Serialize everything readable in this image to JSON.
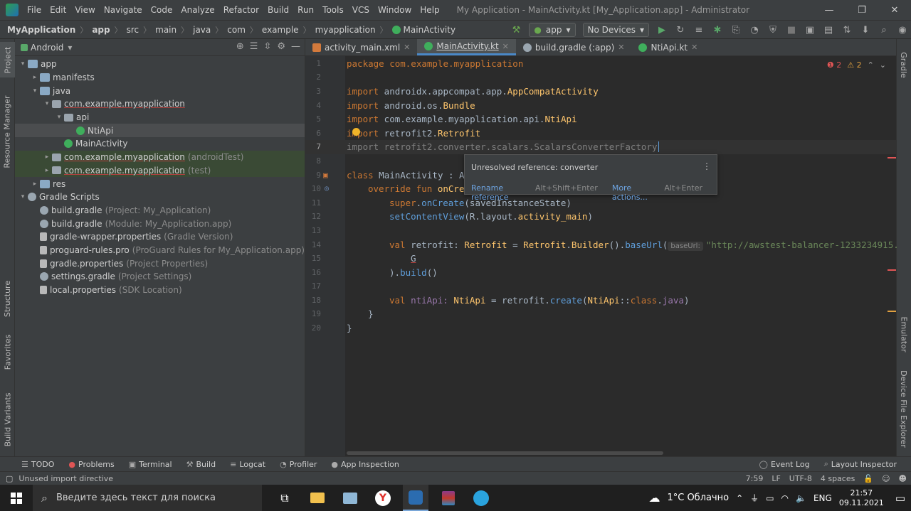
{
  "title_bar": {
    "menu": [
      "File",
      "Edit",
      "View",
      "Navigate",
      "Code",
      "Analyze",
      "Refactor",
      "Build",
      "Run",
      "Tools",
      "VCS",
      "Window",
      "Help"
    ],
    "window_title": "My Application - MainActivity.kt [My_Application.app] - Administrator"
  },
  "breadcrumbs": [
    "MyApplication",
    "app",
    "src",
    "main",
    "java",
    "com",
    "example",
    "myapplication",
    "MainActivity"
  ],
  "toolbar": {
    "run_config": "app",
    "device": "No Devices"
  },
  "left_stripe": [
    "Project",
    "Resource Manager",
    "Structure",
    "Favorites",
    "Build Variants"
  ],
  "right_stripe": [
    "Gradle",
    "Emulator",
    "Device File Explorer"
  ],
  "project_panel": {
    "view_mode": "Android",
    "tree": [
      {
        "label": "app",
        "hint": "",
        "depth": 0,
        "arrow": "▾",
        "icon": "folder"
      },
      {
        "label": "manifests",
        "hint": "",
        "depth": 1,
        "arrow": "▸",
        "icon": "folder"
      },
      {
        "label": "java",
        "hint": "",
        "depth": 1,
        "arrow": "▾",
        "icon": "folder"
      },
      {
        "label": "com.example.myapplication",
        "hint": "",
        "depth": 2,
        "arrow": "▾",
        "icon": "pkg"
      },
      {
        "label": "api",
        "hint": "",
        "depth": 3,
        "arrow": "▾",
        "icon": "pkg"
      },
      {
        "label": "NtiApi",
        "hint": "",
        "depth": 4,
        "arrow": "",
        "icon": "kt"
      },
      {
        "label": "MainActivity",
        "hint": "",
        "depth": 3,
        "arrow": "",
        "icon": "kt"
      },
      {
        "label": "com.example.myapplication",
        "hint": "(androidTest)",
        "depth": 2,
        "arrow": "▸",
        "icon": "pkg"
      },
      {
        "label": "com.example.myapplication",
        "hint": "(test)",
        "depth": 2,
        "arrow": "▸",
        "icon": "pkg"
      },
      {
        "label": "res",
        "hint": "",
        "depth": 1,
        "arrow": "▸",
        "icon": "folder"
      },
      {
        "label": "Gradle Scripts",
        "hint": "",
        "depth": 0,
        "arrow": "▾",
        "icon": "gradle"
      },
      {
        "label": "build.gradle",
        "hint": "(Project: My_Application)",
        "depth": 1,
        "arrow": "",
        "icon": "gradle"
      },
      {
        "label": "build.gradle",
        "hint": "(Module: My_Application.app)",
        "depth": 1,
        "arrow": "",
        "icon": "gradle"
      },
      {
        "label": "gradle-wrapper.properties",
        "hint": "(Gradle Version)",
        "depth": 1,
        "arrow": "",
        "icon": "file"
      },
      {
        "label": "proguard-rules.pro",
        "hint": "(ProGuard Rules for My_Application.app)",
        "depth": 1,
        "arrow": "",
        "icon": "file"
      },
      {
        "label": "gradle.properties",
        "hint": "(Project Properties)",
        "depth": 1,
        "arrow": "",
        "icon": "file"
      },
      {
        "label": "settings.gradle",
        "hint": "(Project Settings)",
        "depth": 1,
        "arrow": "",
        "icon": "gradle"
      },
      {
        "label": "local.properties",
        "hint": "(SDK Location)",
        "depth": 1,
        "arrow": "",
        "icon": "file"
      }
    ]
  },
  "editor_tabs": [
    {
      "label": "activity_main.xml",
      "active": false
    },
    {
      "label": "MainActivity.kt",
      "active": true
    },
    {
      "label": "build.gradle (:app)",
      "active": false
    },
    {
      "label": "NtiApi.kt",
      "active": false
    }
  ],
  "inspections": {
    "errors": "2",
    "warnings": "2"
  },
  "code_lines": [
    "1",
    "2",
    "3",
    "4",
    "5",
    "6",
    "7",
    "8",
    "9",
    "10",
    "11",
    "12",
    "13",
    "14",
    "15",
    "16",
    "17",
    "18",
    "19",
    "20"
  ],
  "code": {
    "l1": "package com.example.myapplication",
    "l3a": "import",
    "l3b": " androidx.appcompat.app.",
    "l3c": "AppCompatActivity",
    "l4a": "import",
    "l4b": " android.os.",
    "l4c": "Bundle",
    "l5a": "import",
    "l5b": " com.example.myapplication.api.",
    "l5c": "NtiApi",
    "l6a": "import",
    "l6b": " retrofit2.",
    "l6c": "Retrofit",
    "l7": "import retrofit2.converter.scalars.ScalarsConverterFactory",
    "l9a": "class",
    "l9b": " MainActivity : A",
    "l10a": "override fun",
    "l10b": " onCre",
    "l11a": "super",
    "l11b": ".",
    "l11c": "onCreate",
    "l11d": "(savedInstanceState)",
    "l12a": "setContentView",
    "l12b": "(R.layout.",
    "l12c": "activity_main",
    "l12d": ")",
    "l14a": "val",
    "l14b": " retrofit: ",
    "l14c": "Retrofit",
    "l14d": " = ",
    "l14e": "Retrofit",
    "l14f": ".",
    "l14g": "Builder",
    "l14h": "().",
    "l14i": "baseUrl",
    "l14j": "(",
    "l14k": "baseUrl:",
    "l14l": "\"http://awstest-balancer-1233234915.",
    "l15": "G",
    "l16a": ").",
    "l16b": "build",
    "l16c": "()",
    "l18a": "val",
    "l18b": " ntiApi: ",
    "l18c": "NtiApi",
    "l18d": " = retrofit.",
    "l18e": "create",
    "l18f": "(",
    "l18g": "NtiApi",
    "l18h": "::",
    "l18i": "class",
    "l18j": ".",
    "l18k": "java",
    "l18l": ")",
    "l19": "}",
    "l20": "}"
  },
  "popup": {
    "message": "Unresolved reference: converter",
    "action1": "Rename reference",
    "key1": "Alt+Shift+Enter",
    "action2": "More actions...",
    "key2": "Alt+Enter"
  },
  "tool_windows": [
    "TODO",
    "Problems",
    "Terminal",
    "Build",
    "Logcat",
    "Profiler",
    "App Inspection"
  ],
  "tool_windows_right": [
    "Event Log",
    "Layout Inspector"
  ],
  "status": {
    "message": "Unused import directive",
    "position": "7:59",
    "line_sep": "LF",
    "encoding": "UTF-8",
    "indent": "4 spaces"
  },
  "taskbar": {
    "search_placeholder": "Введите здесь текст для поиска",
    "weather": "1°C Облачно",
    "lang": "ENG",
    "time": "21:57",
    "date": "09.11.2021"
  },
  "colors": {
    "accent": "#4a88c7",
    "keyword": "#cc7832",
    "string": "#6a8759",
    "function": "#ffc66d",
    "error": "#e05555",
    "warning": "#e0a040"
  }
}
